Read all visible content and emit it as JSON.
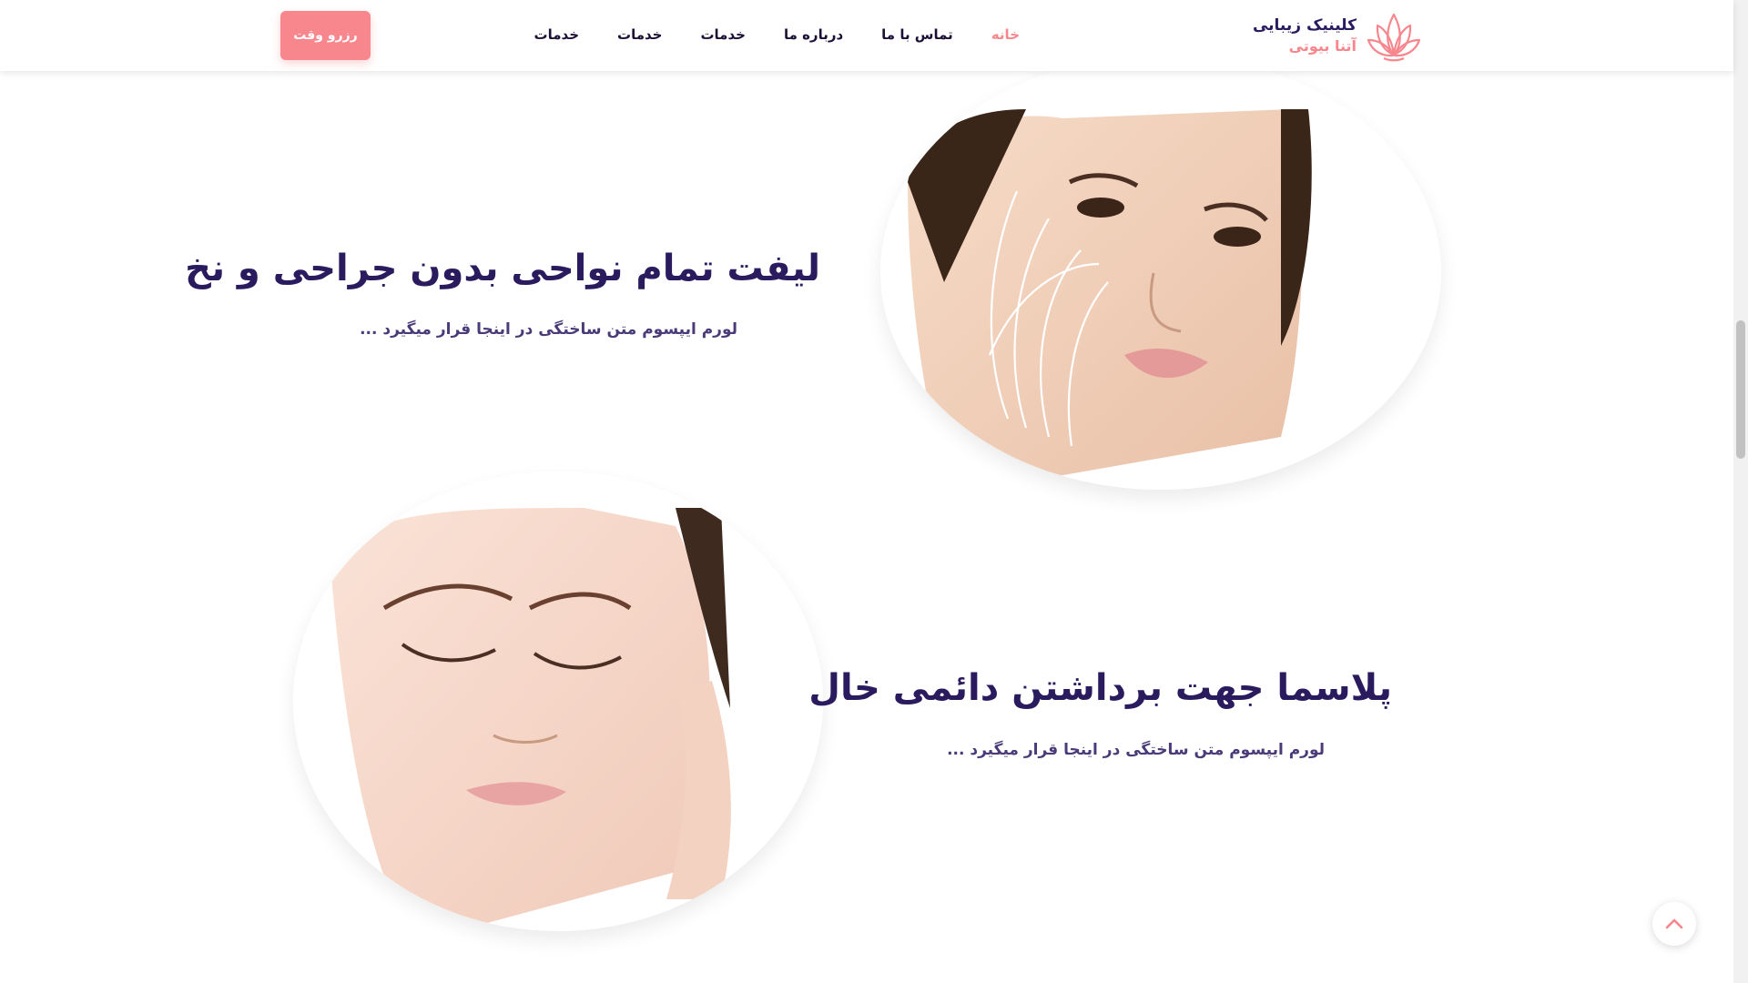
{
  "header": {
    "logo": {
      "line1": "کلینیک زیبایی",
      "line2": "آتنا بیوتی",
      "icon": "lotus-icon"
    },
    "nav": [
      {
        "label": "خانه",
        "active": true
      },
      {
        "label": "تماس با ما",
        "active": false
      },
      {
        "label": "درباره ما",
        "active": false
      },
      {
        "label": "خدمات",
        "active": false
      },
      {
        "label": "خدمات",
        "active": false
      },
      {
        "label": "خدمات",
        "active": false
      }
    ],
    "reserve_label": "رزرو وقت"
  },
  "sections": [
    {
      "title": "لیفت تمام نواحی بدون جراحی و نخ",
      "desc": "لورم ایپسوم متن ساختگی در اینجا قرار میگیرد ..."
    },
    {
      "title": "پلاسما جهت برداشتن دائمی خال",
      "desc": "لورم ایپسوم متن ساختگی در اینجا قرار میگیرد ..."
    }
  ],
  "back_to_top_icon": "chevron-up-icon",
  "colors": {
    "accent": "#f7868d",
    "heading": "#2a1a5e",
    "text": "#1c1036"
  }
}
